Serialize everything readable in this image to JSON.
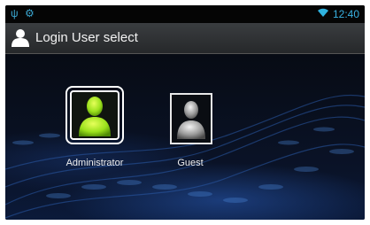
{
  "status_bar": {
    "icons": [
      "usb-icon",
      "debug-icon",
      "wifi-icon"
    ],
    "time": "12:40"
  },
  "title_bar": {
    "icon": "user-icon",
    "title": "Login User select"
  },
  "users": [
    {
      "name": "Administrator",
      "selected": true,
      "color": "#9be11c"
    },
    {
      "name": "Guest",
      "selected": false,
      "color": "#9a9a9a"
    }
  ]
}
